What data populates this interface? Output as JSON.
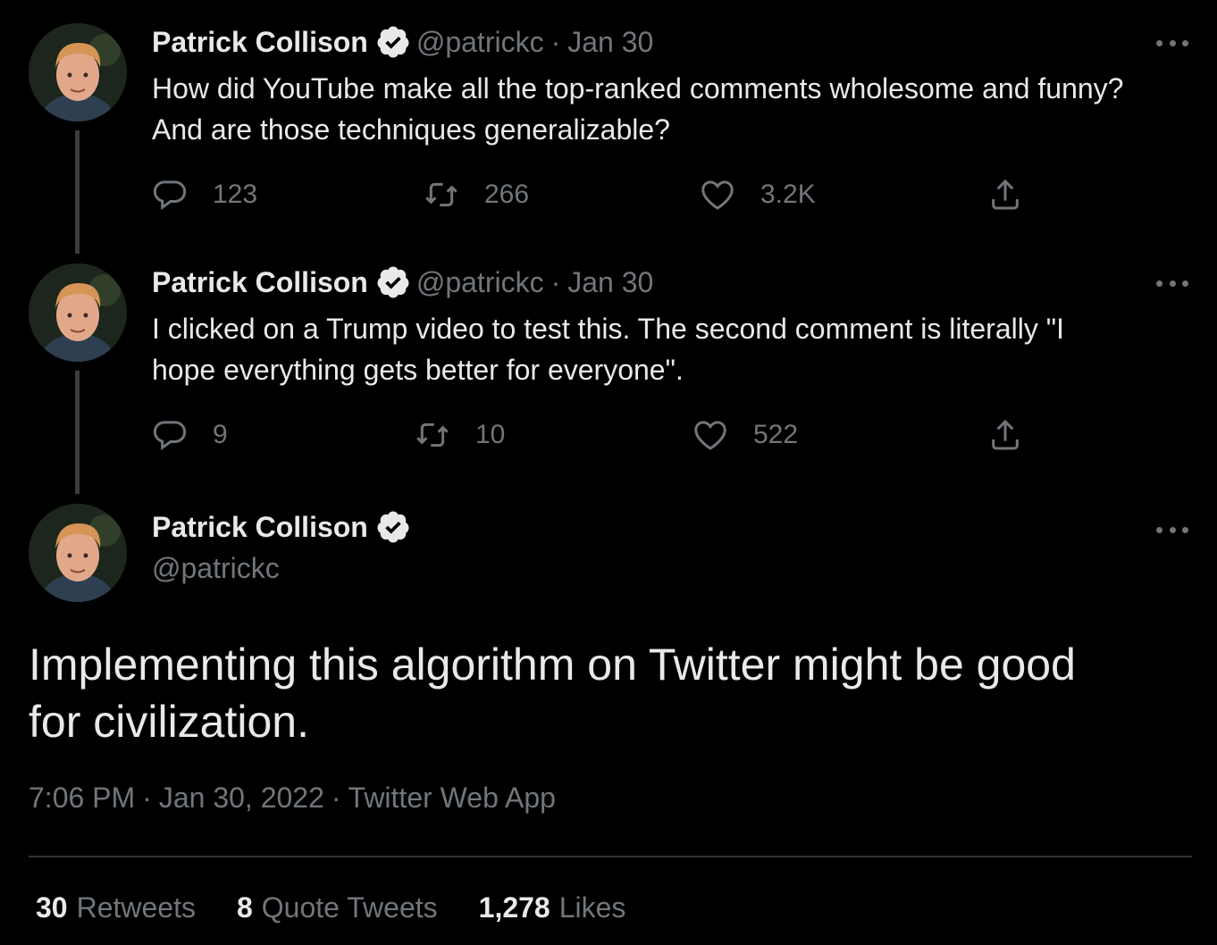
{
  "author": {
    "name": "Patrick Collison",
    "handle": "@patrickc"
  },
  "thread": [
    {
      "date": "Jan 30",
      "text_lines": [
        "How did YouTube make all the top-ranked comments wholesome and funny?",
        "And are those techniques generalizable?"
      ],
      "replies": "123",
      "retweets": "266",
      "likes": "3.2K"
    },
    {
      "date": "Jan 30",
      "text_lines": [
        "I clicked on a Trump video to test this. The second comment is literally \"I",
        "hope everything gets better for everyone\"."
      ],
      "replies": "9",
      "retweets": "10",
      "likes": "522"
    }
  ],
  "main": {
    "text_lines": [
      "Implementing this algorithm on Twitter might be good",
      "for civilization."
    ],
    "time": "7:06 PM",
    "date": "Jan 30, 2022",
    "source": "Twitter Web App",
    "stats": {
      "retweets_num": "30",
      "retweets_label": "Retweets",
      "quotes_num": "8",
      "quotes_label": "Quote Tweets",
      "likes_num": "1,278",
      "likes_label": "Likes"
    }
  },
  "separator": "·",
  "colors": {
    "background": "#000000",
    "text": "#e7e9ea",
    "muted": "#71767b",
    "verified_badge": "#e7e9ea"
  }
}
